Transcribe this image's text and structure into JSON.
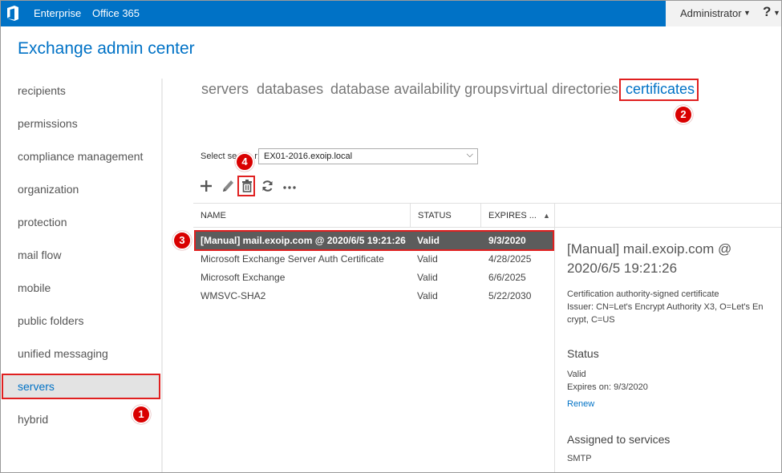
{
  "topbar": {
    "logo_icon": "office-logo-icon",
    "tabs": [
      "Enterprise",
      "Office 365"
    ],
    "user": "Administrator",
    "help": "?"
  },
  "app_title": "Exchange admin center",
  "sidebar": {
    "items": [
      {
        "label": "recipients"
      },
      {
        "label": "permissions"
      },
      {
        "label": "compliance management"
      },
      {
        "label": "organization"
      },
      {
        "label": "protection"
      },
      {
        "label": "mail flow"
      },
      {
        "label": "mobile"
      },
      {
        "label": "public folders"
      },
      {
        "label": "unified messaging"
      },
      {
        "label": "servers",
        "selected": true
      },
      {
        "label": "hybrid"
      }
    ]
  },
  "topnav": [
    "servers",
    "databases",
    "database availability groups",
    "virtual directories",
    "certificates"
  ],
  "select_server": {
    "label": "Select se",
    "label_tail": "r:",
    "value": "EX01-2016.exoip.local"
  },
  "toolbar": {
    "icons": [
      "add-icon",
      "edit-icon",
      "delete-icon",
      "refresh-icon",
      "more-icon"
    ]
  },
  "table": {
    "columns": [
      "NAME",
      "STATUS",
      "EXPIRES ..."
    ],
    "sort_indicator": "▲",
    "rows": [
      {
        "name": "[Manual] mail.exoip.com @ 2020/6/5 19:21:26",
        "status": "Valid",
        "expires": "9/3/2020",
        "selected": true
      },
      {
        "name": "Microsoft Exchange Server Auth Certificate",
        "status": "Valid",
        "expires": "4/28/2025"
      },
      {
        "name": "Microsoft Exchange",
        "status": "Valid",
        "expires": "6/6/2025"
      },
      {
        "name": "WMSVC-SHA2",
        "status": "Valid",
        "expires": "5/22/2030"
      }
    ]
  },
  "details": {
    "title_line1": "[Manual] mail.exoip.com @",
    "title_line2": "2020/6/5 19:21:26",
    "type": "Certification authority-signed certificate",
    "issuer_line1": "Issuer: CN=Let's Encrypt Authority X3, O=Let's En",
    "issuer_line2": "crypt, C=US",
    "status_heading": "Status",
    "status_value": "Valid",
    "expires": "Expires on: 9/3/2020",
    "renew_link": "Renew",
    "services_heading": "Assigned to services",
    "services_value": "SMTP"
  },
  "annotations": [
    "1",
    "2",
    "3",
    "4"
  ],
  "colors": {
    "brand": "#0072c6",
    "highlight": "#e02020",
    "badge": "#d90000",
    "selected_row": "#5c5c5c"
  }
}
